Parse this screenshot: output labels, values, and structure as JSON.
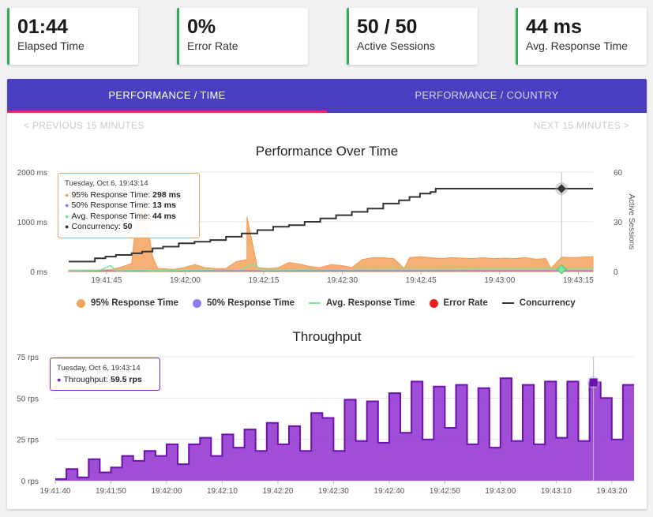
{
  "stats": [
    {
      "value": "01:44",
      "label": "Elapsed Time"
    },
    {
      "value": "0%",
      "label": "Error Rate"
    },
    {
      "value": "50 / 50",
      "label": "Active Sessions"
    },
    {
      "value": "44 ms",
      "label": "Avg. Response Time"
    }
  ],
  "colors": {
    "accent_green": "#2fae55",
    "tab_bar": "#4a3fc0",
    "tab_indicator": "#e8305e",
    "p95": "#f5a25d",
    "p50": "#8b7cf0",
    "avg": "#7fe39a",
    "error": "#e8211c",
    "concurrency": "#333333",
    "throughput": "#7b1fc2"
  },
  "tabs": [
    {
      "label": "PERFORMANCE / TIME",
      "active": true
    },
    {
      "label": "PERFORMANCE / COUNTRY",
      "active": false
    }
  ],
  "nav": {
    "prev": "< PREVIOUS 15 MINUTES",
    "next": "NEXT 15 MINUTES >"
  },
  "chart_data": [
    {
      "type": "area",
      "title": "Performance Over Time",
      "x_ticks": [
        "19:41:45",
        "19:42:00",
        "19:42:15",
        "19:42:30",
        "19:42:45",
        "19:43:00",
        "19:43:15"
      ],
      "y_ticks": [
        "0 ms",
        "1000 ms",
        "2000 ms"
      ],
      "y2_ticks": [
        "0",
        "30",
        "60"
      ],
      "y2label": "Active Sessions",
      "ylim": [
        0,
        2000
      ],
      "y2lim": [
        0,
        60
      ],
      "x_start_seconds": 0,
      "x_end_seconds": 100,
      "legend": [
        "95% Response Time",
        "50% Response Time",
        "Avg. Response Time",
        "Error Rate",
        "Concurrency"
      ],
      "series": [
        {
          "name": "95% Response Time",
          "kind": "area",
          "points": [
            [
              0,
              30
            ],
            [
              5,
              30
            ],
            [
              8,
              40
            ],
            [
              10,
              90
            ],
            [
              12,
              160
            ],
            [
              14,
              1600
            ],
            [
              16,
              300
            ],
            [
              18,
              60
            ],
            [
              20,
              40
            ],
            [
              22,
              80
            ],
            [
              24,
              140
            ],
            [
              26,
              80
            ],
            [
              28,
              60
            ],
            [
              30,
              60
            ],
            [
              32,
              200
            ],
            [
              34,
              240
            ],
            [
              36,
              80
            ],
            [
              38,
              60
            ],
            [
              40,
              80
            ],
            [
              42,
              180
            ],
            [
              44,
              150
            ],
            [
              46,
              100
            ],
            [
              48,
              80
            ],
            [
              50,
              140
            ],
            [
              52,
              120
            ],
            [
              54,
              80
            ],
            [
              56,
              240
            ],
            [
              58,
              280
            ],
            [
              60,
              280
            ],
            [
              62,
              260
            ],
            [
              64,
              60
            ],
            [
              65,
              280
            ],
            [
              67,
              300
            ],
            [
              69,
              280
            ],
            [
              71,
              260
            ],
            [
              73,
              280
            ],
            [
              75,
              270
            ],
            [
              77,
              260
            ],
            [
              79,
              280
            ],
            [
              81,
              260
            ],
            [
              83,
              270
            ],
            [
              85,
              260
            ],
            [
              87,
              280
            ],
            [
              89,
              250
            ],
            [
              91,
              260
            ],
            [
              92,
              60
            ],
            [
              93,
              180
            ],
            [
              94,
              290
            ],
            [
              96,
              280
            ],
            [
              98,
              290
            ],
            [
              100,
              298
            ]
          ],
          "peaks": [
            [
              10,
              90
            ],
            [
              13.5,
              1650
            ],
            [
              17,
              60
            ],
            [
              30,
              60
            ],
            [
              34,
              1100
            ],
            [
              36,
              80
            ]
          ]
        },
        {
          "name": "50% Response Time",
          "kind": "line",
          "points": [
            [
              0,
              10
            ],
            [
              20,
              12
            ],
            [
              40,
              13
            ],
            [
              60,
              12
            ],
            [
              80,
              13
            ],
            [
              100,
              13
            ]
          ]
        },
        {
          "name": "Avg. Response Time",
          "kind": "line",
          "points": [
            [
              0,
              20
            ],
            [
              6,
              30
            ],
            [
              8,
              120
            ],
            [
              9,
              20
            ],
            [
              14,
              30
            ],
            [
              16,
              20
            ],
            [
              33,
              40
            ],
            [
              35,
              150
            ],
            [
              37,
              30
            ],
            [
              60,
              40
            ],
            [
              70,
              40
            ],
            [
              80,
              44
            ],
            [
              100,
              44
            ]
          ]
        },
        {
          "name": "Concurrency",
          "kind": "line",
          "axis": "y2",
          "points": [
            [
              0,
              6
            ],
            [
              3,
              6
            ],
            [
              5,
              8
            ],
            [
              7,
              9
            ],
            [
              9,
              10
            ],
            [
              12,
              11
            ],
            [
              14,
              12
            ],
            [
              16,
              14
            ],
            [
              18,
              15
            ],
            [
              21,
              17
            ],
            [
              24,
              18
            ],
            [
              27,
              19
            ],
            [
              30,
              21
            ],
            [
              33,
              23
            ],
            [
              36,
              25
            ],
            [
              39,
              27
            ],
            [
              42,
              28
            ],
            [
              45,
              30
            ],
            [
              48,
              32
            ],
            [
              51,
              34
            ],
            [
              54,
              36
            ],
            [
              57,
              38
            ],
            [
              60,
              41
            ],
            [
              63,
              43
            ],
            [
              65,
              45
            ],
            [
              67,
              47
            ],
            [
              69,
              48
            ],
            [
              70,
              50
            ],
            [
              100,
              50
            ]
          ]
        }
      ],
      "tooltip": {
        "date": "Tuesday, Oct 6, 19:43:14",
        "rows": [
          {
            "label": "95% Response Time",
            "value": "298 ms"
          },
          {
            "label": "50% Response Time",
            "value": "13 ms"
          },
          {
            "label": "Avg. Response Time",
            "value": "44 ms"
          },
          {
            "label": "Concurrency",
            "value": "50"
          }
        ]
      }
    },
    {
      "type": "bar",
      "title": "Throughput",
      "x_ticks": [
        "19:41:40",
        "19:41:50",
        "19:42:00",
        "19:42:10",
        "19:42:20",
        "19:42:30",
        "19:42:40",
        "19:42:50",
        "19:43:00",
        "19:43:10",
        "19:43:20"
      ],
      "y_ticks": [
        "0 rps",
        "25 rps",
        "50 rps",
        "75 rps"
      ],
      "ylim": [
        0,
        75
      ],
      "series": [
        {
          "name": "Throughput",
          "values": [
            1,
            7,
            2,
            13,
            5,
            8,
            15,
            12,
            18,
            15,
            22,
            10,
            22,
            26,
            15,
            28,
            20,
            31,
            18,
            35,
            22,
            33,
            18,
            41,
            38,
            18,
            49,
            24,
            48,
            23,
            53,
            29,
            60,
            25,
            57,
            32,
            58,
            22,
            56,
            20,
            62,
            24,
            58,
            22,
            60,
            26,
            60,
            24,
            59.5,
            50,
            25,
            58
          ]
        }
      ],
      "tooltip": {
        "date": "Tuesday, Oct 6, 19:43:14",
        "rows": [
          {
            "label": "Throughput",
            "value": "59.5 rps"
          }
        ]
      }
    }
  ]
}
